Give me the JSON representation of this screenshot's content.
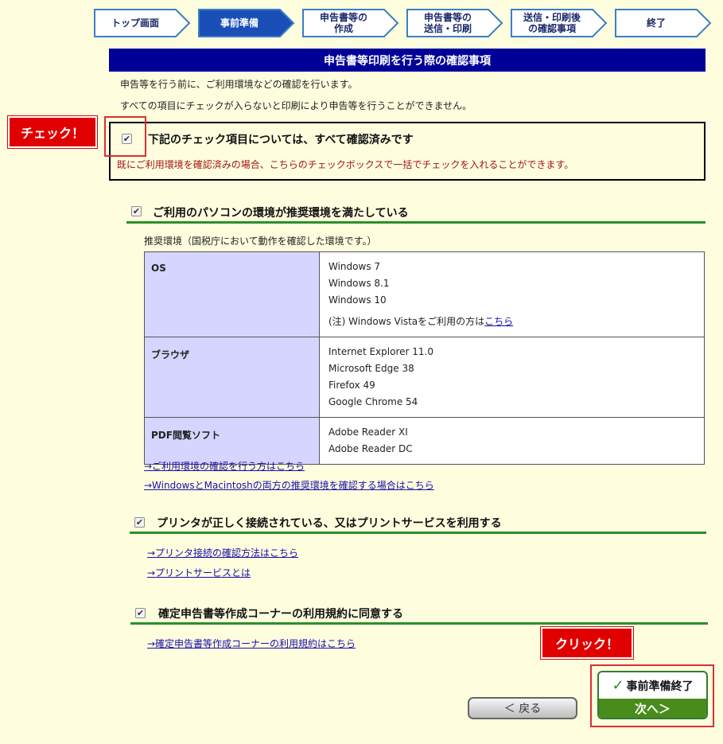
{
  "steps": [
    {
      "label": "トップ画面",
      "current": false
    },
    {
      "label": "事前準備",
      "current": true
    },
    {
      "label": "申告書等の\n作成",
      "current": false
    },
    {
      "label": "申告書等の\n送信・印刷",
      "current": false
    },
    {
      "label": "送信・印刷後\nの確認事項",
      "current": false
    },
    {
      "label": "終了",
      "current": false
    }
  ],
  "header": {
    "title": "申告書等印刷を行う際の確認事項"
  },
  "intro": {
    "line1": "申告等を行う前に、ご利用環境などの確認を行います。",
    "line2": "すべての項目にチェックが入らないと印刷により申告等を行うことができません。"
  },
  "bulk": {
    "label": "下記のチェック項目については、すべて確認済みです",
    "note": "既にご利用環境を確認済みの場合、こちらのチェックボックスで一括でチェックを入れることができます。",
    "checked": true
  },
  "annotations": {
    "check": "チェック！",
    "click": "クリック！"
  },
  "section_pc": {
    "title": "ご利用のパソコンの環境が推奨環境を満たしている",
    "recommended": "推奨環境（国税庁において動作を確認した環境です。）",
    "rows": [
      {
        "key": "OS",
        "values": [
          "Windows 7",
          "Windows 8.1",
          "Windows 10"
        ],
        "note_prefix": "(注) Windows Vistaをご利用の方は",
        "note_link": "こちら"
      },
      {
        "key": "ブラウザ",
        "values": [
          "Internet Explorer 11.0",
          "Microsoft Edge 38",
          "Firefox 49",
          "Google Chrome 54"
        ]
      },
      {
        "key": "PDF閲覧ソフト",
        "values": [
          "Adobe Reader XI",
          "Adobe Reader DC"
        ]
      }
    ],
    "link1": "→ご利用環境の確認を行う方はこちら",
    "link2": "→WindowsとMacintoshの両方の推奨環境を確認する場合はこちら"
  },
  "section_printer": {
    "title": "プリンタが正しく接続されている、又はプリントサービスを利用する",
    "link1": "→プリンタ接続の確認方法はこちら",
    "link2": "→プリントサービスとは"
  },
  "section_terms": {
    "title": "確定申告書等作成コーナーの利用規約に同意する",
    "link1": "→確定申告書等作成コーナーの利用規約はこちら"
  },
  "buttons": {
    "back": "＜ 戻る",
    "done_top": "事前準備終了",
    "done_bottom": "次へ＞"
  },
  "colors": {
    "navy": "#000099",
    "green": "#2b8f2b",
    "red": "#e00000",
    "page": "#fefedf"
  }
}
